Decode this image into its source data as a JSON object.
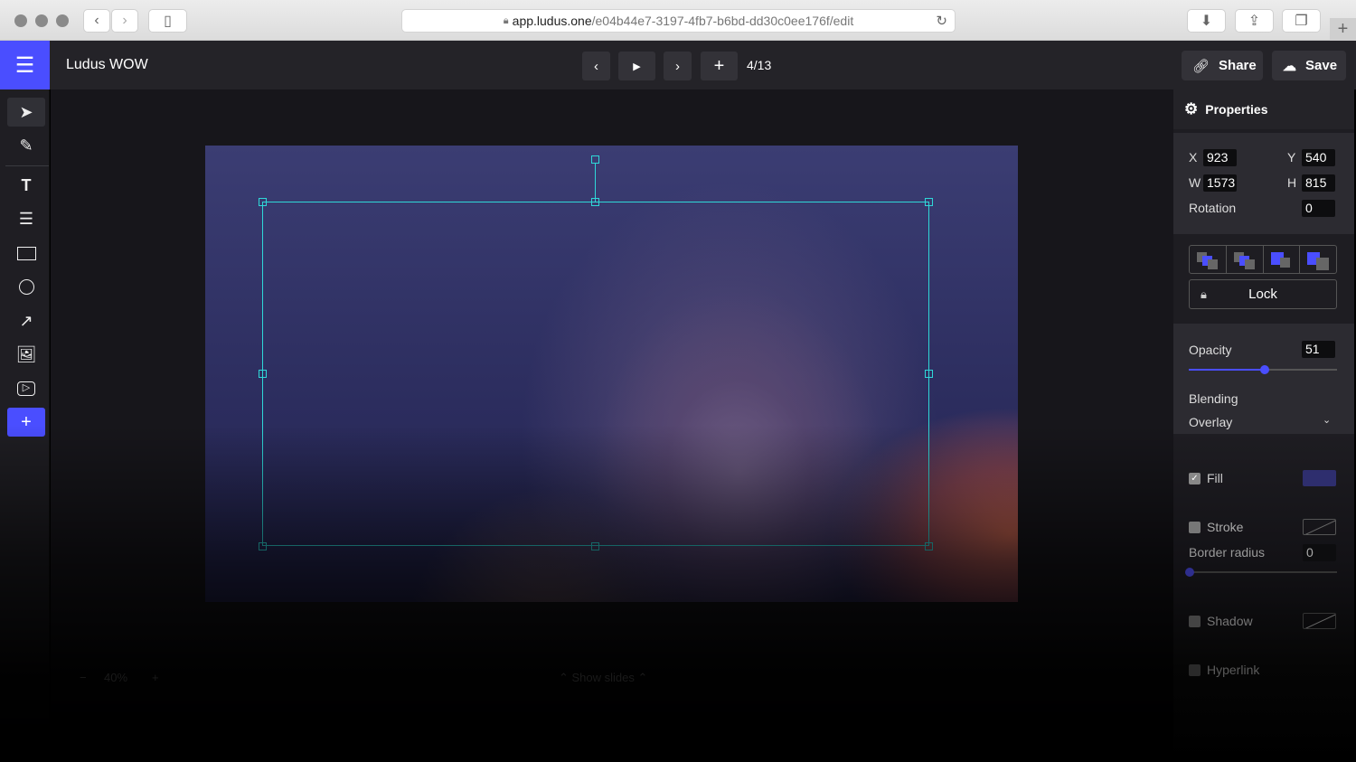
{
  "browser": {
    "url_host": "app.ludus.one",
    "url_path": "/e04b44e7-3197-4fb7-b6bd-dd30c0ee176f/edit"
  },
  "header": {
    "title": "Ludus WOW",
    "page_indicator": "4/13",
    "share_label": "Share",
    "save_label": "Save"
  },
  "tools": [
    "select",
    "pen",
    "text",
    "list",
    "rectangle",
    "ellipse",
    "arrow",
    "image",
    "video",
    "add"
  ],
  "properties": {
    "title": "Properties",
    "x": "923",
    "y": "540",
    "w": "1573",
    "h": "815",
    "rotation": "0",
    "labels": {
      "x": "X",
      "y": "Y",
      "w": "W",
      "h": "H",
      "rotation": "Rotation"
    },
    "lock_label": "Lock",
    "opacity_label": "Opacity",
    "opacity": "51",
    "opacity_fraction": 0.51,
    "blending_label": "Blending",
    "blending": "Overlay",
    "fill_label": "Fill",
    "fill_checked": true,
    "fill_color": "#2e2e6e",
    "stroke_label": "Stroke",
    "stroke_checked": false,
    "border_radius_label": "Border radius",
    "border_radius": "0",
    "shadow_label": "Shadow",
    "shadow_checked": false,
    "hyperlink_label": "Hyperlink"
  },
  "footer": {
    "zoom": "40%",
    "show_slides": "Show slides"
  },
  "colors": {
    "accent": "#4a4eff",
    "selection": "#2fd8d8"
  }
}
